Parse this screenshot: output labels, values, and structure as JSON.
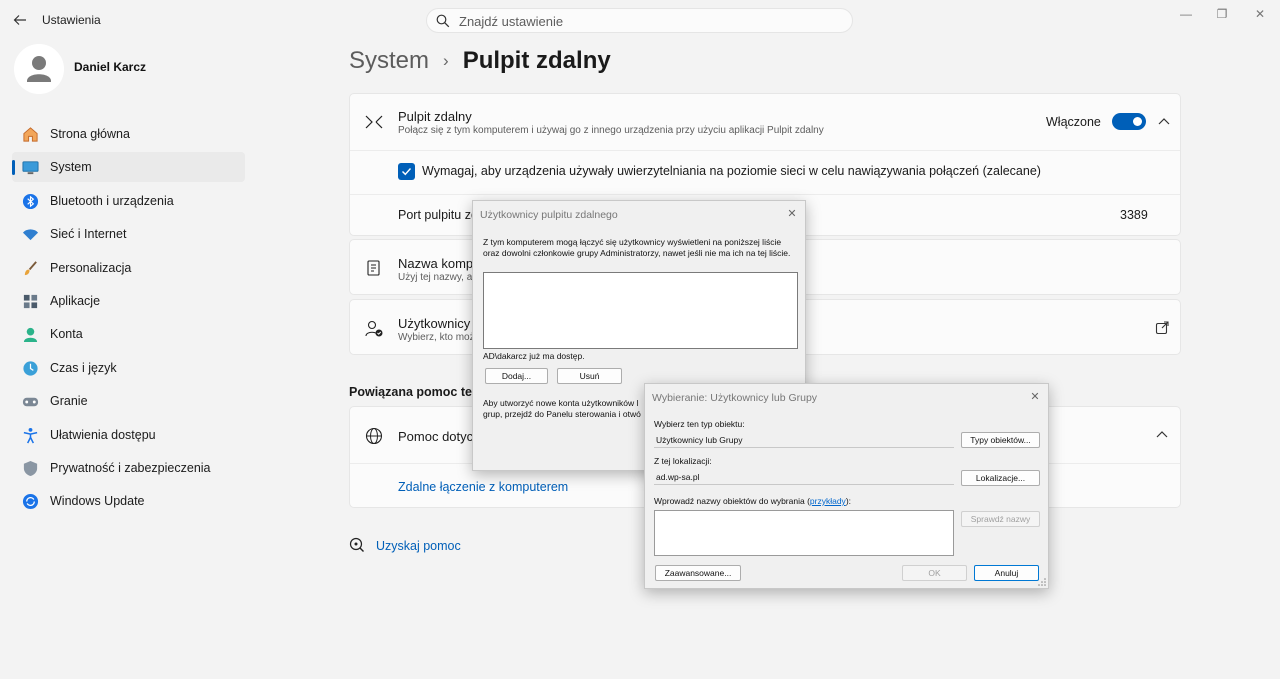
{
  "window": {
    "app_title": "Ustawienia",
    "back_icon": "back-arrow-icon",
    "controls": {
      "minimize": "—",
      "maximize": "❐",
      "close": "✕"
    }
  },
  "search": {
    "placeholder": "Znajdź ustawienie"
  },
  "profile": {
    "name": "Daniel Karcz"
  },
  "sidebar": {
    "items": [
      {
        "label": "Strona główna",
        "icon": "home-icon",
        "active": false
      },
      {
        "label": "System",
        "icon": "monitor-icon",
        "active": true
      },
      {
        "label": "Bluetooth i urządzenia",
        "icon": "bluetooth-icon",
        "active": false
      },
      {
        "label": "Sieć i Internet",
        "icon": "wifi-icon",
        "active": false
      },
      {
        "label": "Personalizacja",
        "icon": "brush-icon",
        "active": false
      },
      {
        "label": "Aplikacje",
        "icon": "apps-icon",
        "active": false
      },
      {
        "label": "Konta",
        "icon": "account-icon",
        "active": false
      },
      {
        "label": "Czas i język",
        "icon": "globe-clock-icon",
        "active": false
      },
      {
        "label": "Granie",
        "icon": "gamepad-icon",
        "active": false
      },
      {
        "label": "Ułatwienia dostępu",
        "icon": "accessibility-icon",
        "active": false
      },
      {
        "label": "Prywatność i zabezpieczenia",
        "icon": "shield-icon",
        "active": false
      },
      {
        "label": "Windows Update",
        "icon": "update-icon",
        "active": false
      }
    ]
  },
  "breadcrumb": {
    "parent": "System",
    "separator": "›",
    "current": "Pulpit zdalny"
  },
  "remote_desktop": {
    "title": "Pulpit zdalny",
    "subtitle": "Połącz się z tym komputerem i używaj go z innego urządzenia przy użyciu aplikacji Pulpit zdalny",
    "toggle_label": "Włączone",
    "toggle_on": true,
    "nla_label": "Wymagaj, aby urządzenia używały uwierzytelniania na poziomie sieci w celu nawiązywania połączeń (zalecane)",
    "nla_checked": true,
    "port_label": "Port pulpitu zd",
    "port_value": "3389"
  },
  "pc_name": {
    "title": "Nazwa komput",
    "subtitle": "Użyj tej nazwy, a"
  },
  "users": {
    "title": "Użytkownicy p",
    "subtitle": "Wybierz, kto moż"
  },
  "related_help": {
    "title": "Powiązana pomoc techr",
    "item_title": "Pomoc dotycza",
    "link": "Zdalne łączenie z komputerem"
  },
  "get_help": {
    "label": "Uzyskaj pomoc"
  },
  "dialog_users": {
    "title": "Użytkownicy pulpitu zdalnego",
    "description": "Z tym komputerem mogą łączyć się użytkownicy wyświetleni na poniższej liście oraz dowolni członkowie grupy Administratorzy, nawet jeśli nie ma ich na tej liście.",
    "access_note": "AD\\dakarcz już ma dostęp.",
    "add_button": "Dodaj...",
    "remove_button": "Usuń",
    "footer_line1": "Aby utworzyć nowe konta użytkowników l",
    "footer_line2": "grup, przejdź do Panelu sterowania i otwó"
  },
  "dialog_select": {
    "title": "Wybieranie: Użytkownicy lub Grupy",
    "object_type_label": "Wybierz ten typ obiektu:",
    "object_type_value": "Użytkownicy lub Grupy",
    "object_types_button": "Typy obiektów...",
    "location_label": "Z tej lokalizacji:",
    "location_value": "ad.wp-sa.pl",
    "locations_button": "Lokalizacje...",
    "names_label_prefix": "Wprowadź nazwy obiektów do wybrania (",
    "names_label_link": "przykłady",
    "names_label_suffix": "):",
    "check_names_button": "Sprawdź nazwy",
    "advanced_button": "Zaawansowane...",
    "ok_button": "OK",
    "cancel_button": "Anuluj"
  },
  "colors": {
    "accent": "#005fb8",
    "background": "#f3f3f3",
    "card": "#fbfbfb"
  }
}
